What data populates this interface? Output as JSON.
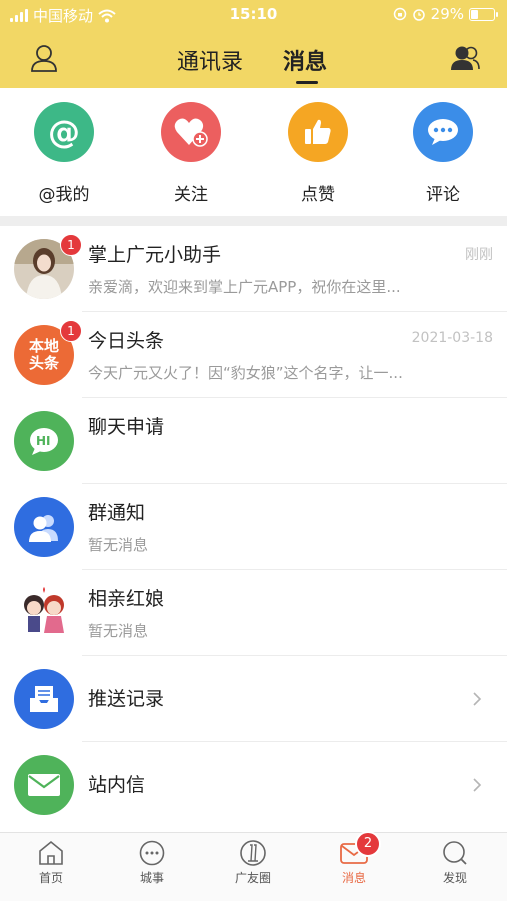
{
  "status_bar": {
    "carrier": "中国移动",
    "time": "15:10",
    "battery_percent": "29%"
  },
  "header": {
    "tabs": [
      {
        "label": "通讯录"
      },
      {
        "label": "消息"
      }
    ],
    "active_tab": "消息",
    "left_icon": "user-icon",
    "right_icon": "contacts-icon",
    "background": "#f2d765"
  },
  "quick_actions": [
    {
      "label": "@我的",
      "icon": "at-icon",
      "color": "#3db887"
    },
    {
      "label": "关注",
      "icon": "heart-plus-icon",
      "color": "#ec5f5f"
    },
    {
      "label": "点赞",
      "icon": "thumbs-up-icon",
      "color": "#f5a623"
    },
    {
      "label": "评论",
      "icon": "chat-bubble-icon",
      "color": "#3b8de8"
    }
  ],
  "messages": [
    {
      "title": "掌上广元小助手",
      "subtitle": "亲爱滴，欢迎来到掌上广元APP，祝你在这里...",
      "time": "刚刚",
      "badge": "1",
      "avatar": "girl-photo-avatar"
    },
    {
      "title": "今日头条",
      "subtitle": "今天广元又火了！因“豹女狼”这个名字，让一...",
      "time": "2021-03-18",
      "badge": "1",
      "avatar": "local-news-avatar",
      "avatar_text_1": "本地",
      "avatar_text_2": "头条"
    },
    {
      "title": "聊天申请",
      "avatar": "hi-chat-icon",
      "avatar_text": "HI"
    },
    {
      "title": "群通知",
      "subtitle": "暂无消息",
      "avatar": "group-icon"
    },
    {
      "title": "相亲红娘",
      "subtitle": "暂无消息",
      "avatar": "matchmaker-cartoon-avatar"
    },
    {
      "title": "推送记录",
      "avatar": "push-inbox-icon"
    },
    {
      "title": "站内信",
      "avatar": "mail-icon"
    }
  ],
  "bottom_nav": [
    {
      "label": "首页",
      "icon": "home-icon"
    },
    {
      "label": "城事",
      "icon": "chat-dots-icon"
    },
    {
      "label": "广友圈",
      "icon": "circle-icon"
    },
    {
      "label": "消息",
      "icon": "message-icon",
      "badge": "2",
      "active": true
    },
    {
      "label": "发现",
      "icon": "search-icon"
    }
  ],
  "colors": {
    "accent": "#e86a45",
    "badge": "#e4393c",
    "header": "#f2d765"
  }
}
